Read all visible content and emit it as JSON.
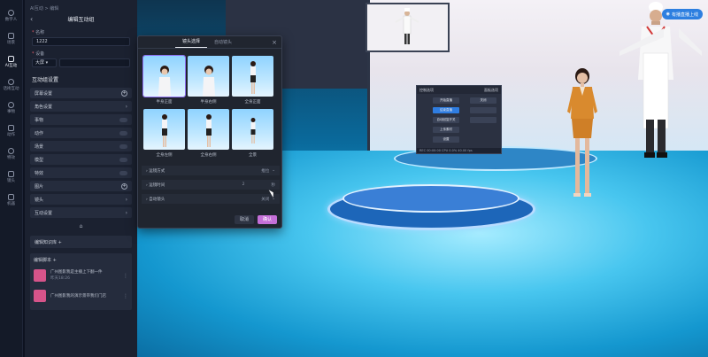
{
  "nav": {
    "items": [
      {
        "label": "数字人",
        "icon": "person-icon"
      },
      {
        "label": "场景",
        "icon": "scene-icon"
      },
      {
        "label": "AI互动",
        "icon": "ai-chat-icon",
        "active": true
      },
      {
        "label": "话術互动",
        "icon": "talk-icon"
      },
      {
        "label": "事物",
        "icon": "object-icon"
      },
      {
        "label": "动作",
        "icon": "motion-icon"
      },
      {
        "label": "特效",
        "icon": "effect-icon"
      },
      {
        "label": "镜头",
        "icon": "camera-icon"
      },
      {
        "label": "机器",
        "icon": "machine-icon"
      }
    ]
  },
  "panel": {
    "breadcrumb": "AI互动 > 编辑",
    "title": "编辑互动组",
    "name_label": "名称",
    "name_value": "1222",
    "device_label": "设备",
    "device_value": "大屏",
    "settings_title": "互动组设置",
    "rows": [
      {
        "label": "屏幕设置",
        "right": "plus"
      },
      {
        "label": "角色设置",
        "right": "chevron"
      },
      {
        "label": "事物",
        "right": "toggle"
      },
      {
        "label": "动作",
        "right": "toggle"
      },
      {
        "label": "场景",
        "right": "toggle"
      },
      {
        "label": "模型",
        "right": "toggle"
      },
      {
        "label": "特效",
        "right": "toggle"
      },
      {
        "label": "图片",
        "right": "plus"
      },
      {
        "label": "镜头",
        "right": "chevron"
      },
      {
        "label": "互动设置",
        "right": "chevron"
      }
    ],
    "knowledge_label": "编辑知识库 +",
    "scripts_title": "编辑脚本 +",
    "scripts": [
      {
        "title": "广州图影我是主播上下翻一件",
        "sub": "昨天18:26"
      },
      {
        "title": "广州图影我的演示景带我们门店",
        "sub": ""
      }
    ]
  },
  "dialog": {
    "tabs": [
      "镜头选择",
      "自动镜头"
    ],
    "active_tab": 0,
    "presets": [
      {
        "label": "半身正面",
        "selected": true
      },
      {
        "label": "半身右侧",
        "selected": false
      },
      {
        "label": "全身正面",
        "selected": false
      },
      {
        "label": "全身左侧",
        "selected": false
      },
      {
        "label": "全身右侧",
        "selected": false
      },
      {
        "label": "全景",
        "selected": false
      }
    ],
    "options": [
      {
        "label": "运镜方式",
        "value": "推拉"
      },
      {
        "label": "运镜时间",
        "value": "2",
        "unit": "秒"
      },
      {
        "label": "自动镜头",
        "value": "关闭"
      }
    ],
    "cancel_label": "取消",
    "ok_label": "确认"
  },
  "scene": {
    "live_button": "有播直播上线",
    "console": {
      "col1_title": "控制选项",
      "col2_title": "面板选项",
      "buttons": [
        "开始直播",
        "结束直播",
        "自动回复开关",
        "上传素材",
        "设置",
        "关闭"
      ],
      "status": "REC 00:00:00  CPU 0.0%  40.00 fps"
    }
  }
}
